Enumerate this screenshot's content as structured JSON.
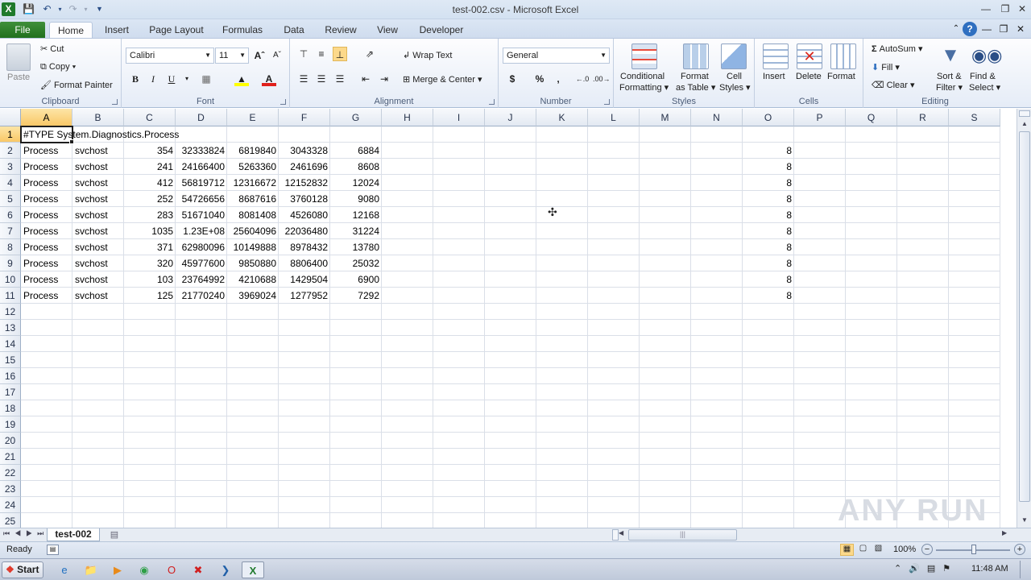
{
  "window": {
    "title": "test-002.csv - Microsoft Excel"
  },
  "tabs": [
    "File",
    "Home",
    "Insert",
    "Page Layout",
    "Formulas",
    "Data",
    "Review",
    "View",
    "Developer"
  ],
  "ribbon": {
    "clipboard": {
      "paste": "Paste",
      "cut": "Cut",
      "copy": "Copy",
      "format_painter": "Format Painter",
      "label": "Clipboard"
    },
    "font": {
      "name": "Calibri",
      "size": "11",
      "bold": "B",
      "italic": "I",
      "underline": "U",
      "label": "Font"
    },
    "alignment": {
      "wrap": "Wrap Text",
      "merge": "Merge & Center",
      "label": "Alignment"
    },
    "number": {
      "format": "General",
      "currency": "$",
      "percent": "%",
      "comma": ",",
      "label": "Number"
    },
    "styles": {
      "conditional_1": "Conditional",
      "conditional_2": "Formatting",
      "format_table_1": "Format",
      "format_table_2": "as Table",
      "cell_styles_1": "Cell",
      "cell_styles_2": "Styles",
      "label": "Styles"
    },
    "cells": {
      "insert": "Insert",
      "delete": "Delete",
      "format": "Format",
      "label": "Cells"
    },
    "editing": {
      "autosum": "AutoSum",
      "fill": "Fill",
      "clear": "Clear",
      "sort_1": "Sort &",
      "sort_2": "Filter",
      "find_1": "Find &",
      "find_2": "Select",
      "label": "Editing"
    }
  },
  "columns": [
    "A",
    "B",
    "C",
    "D",
    "E",
    "F",
    "G",
    "H",
    "I",
    "J",
    "K",
    "L",
    "M",
    "N",
    "O",
    "P",
    "Q",
    "R",
    "S"
  ],
  "rows": [
    "1",
    "2",
    "3",
    "4",
    "5",
    "6",
    "7",
    "8",
    "9",
    "10",
    "11",
    "12",
    "13",
    "14",
    "15",
    "16",
    "17",
    "18",
    "19",
    "20",
    "21",
    "22",
    "23",
    "24",
    "25"
  ],
  "cells": {
    "r1": "#TYPE System.Diagnostics.Process",
    "data": [
      [
        "Process",
        "svchost",
        "354",
        "32333824",
        "6819840",
        "3043328",
        "6884",
        "8"
      ],
      [
        "Process",
        "svchost",
        "241",
        "24166400",
        "5263360",
        "2461696",
        "8608",
        "8"
      ],
      [
        "Process",
        "svchost",
        "412",
        "56819712",
        "12316672",
        "12152832",
        "12024",
        "8"
      ],
      [
        "Process",
        "svchost",
        "252",
        "54726656",
        "8687616",
        "3760128",
        "9080",
        "8"
      ],
      [
        "Process",
        "svchost",
        "283",
        "51671040",
        "8081408",
        "4526080",
        "12168",
        "8"
      ],
      [
        "Process",
        "svchost",
        "1035",
        "1.23E+08",
        "25604096",
        "22036480",
        "31224",
        "8"
      ],
      [
        "Process",
        "svchost",
        "371",
        "62980096",
        "10149888",
        "8978432",
        "13780",
        "8"
      ],
      [
        "Process",
        "svchost",
        "320",
        "45977600",
        "9850880",
        "8806400",
        "25032",
        "8"
      ],
      [
        "Process",
        "svchost",
        "103",
        "23764992",
        "4210688",
        "1429504",
        "6900",
        "8"
      ],
      [
        "Process",
        "svchost",
        "125",
        "21770240",
        "3969024",
        "1277952",
        "7292",
        "8"
      ]
    ]
  },
  "sheet_tab": "test-002",
  "status": {
    "mode": "Ready",
    "zoom": "100%"
  },
  "taskbar": {
    "start": "Start",
    "clock": "11:48 AM"
  },
  "watermark": "ANY RUN"
}
